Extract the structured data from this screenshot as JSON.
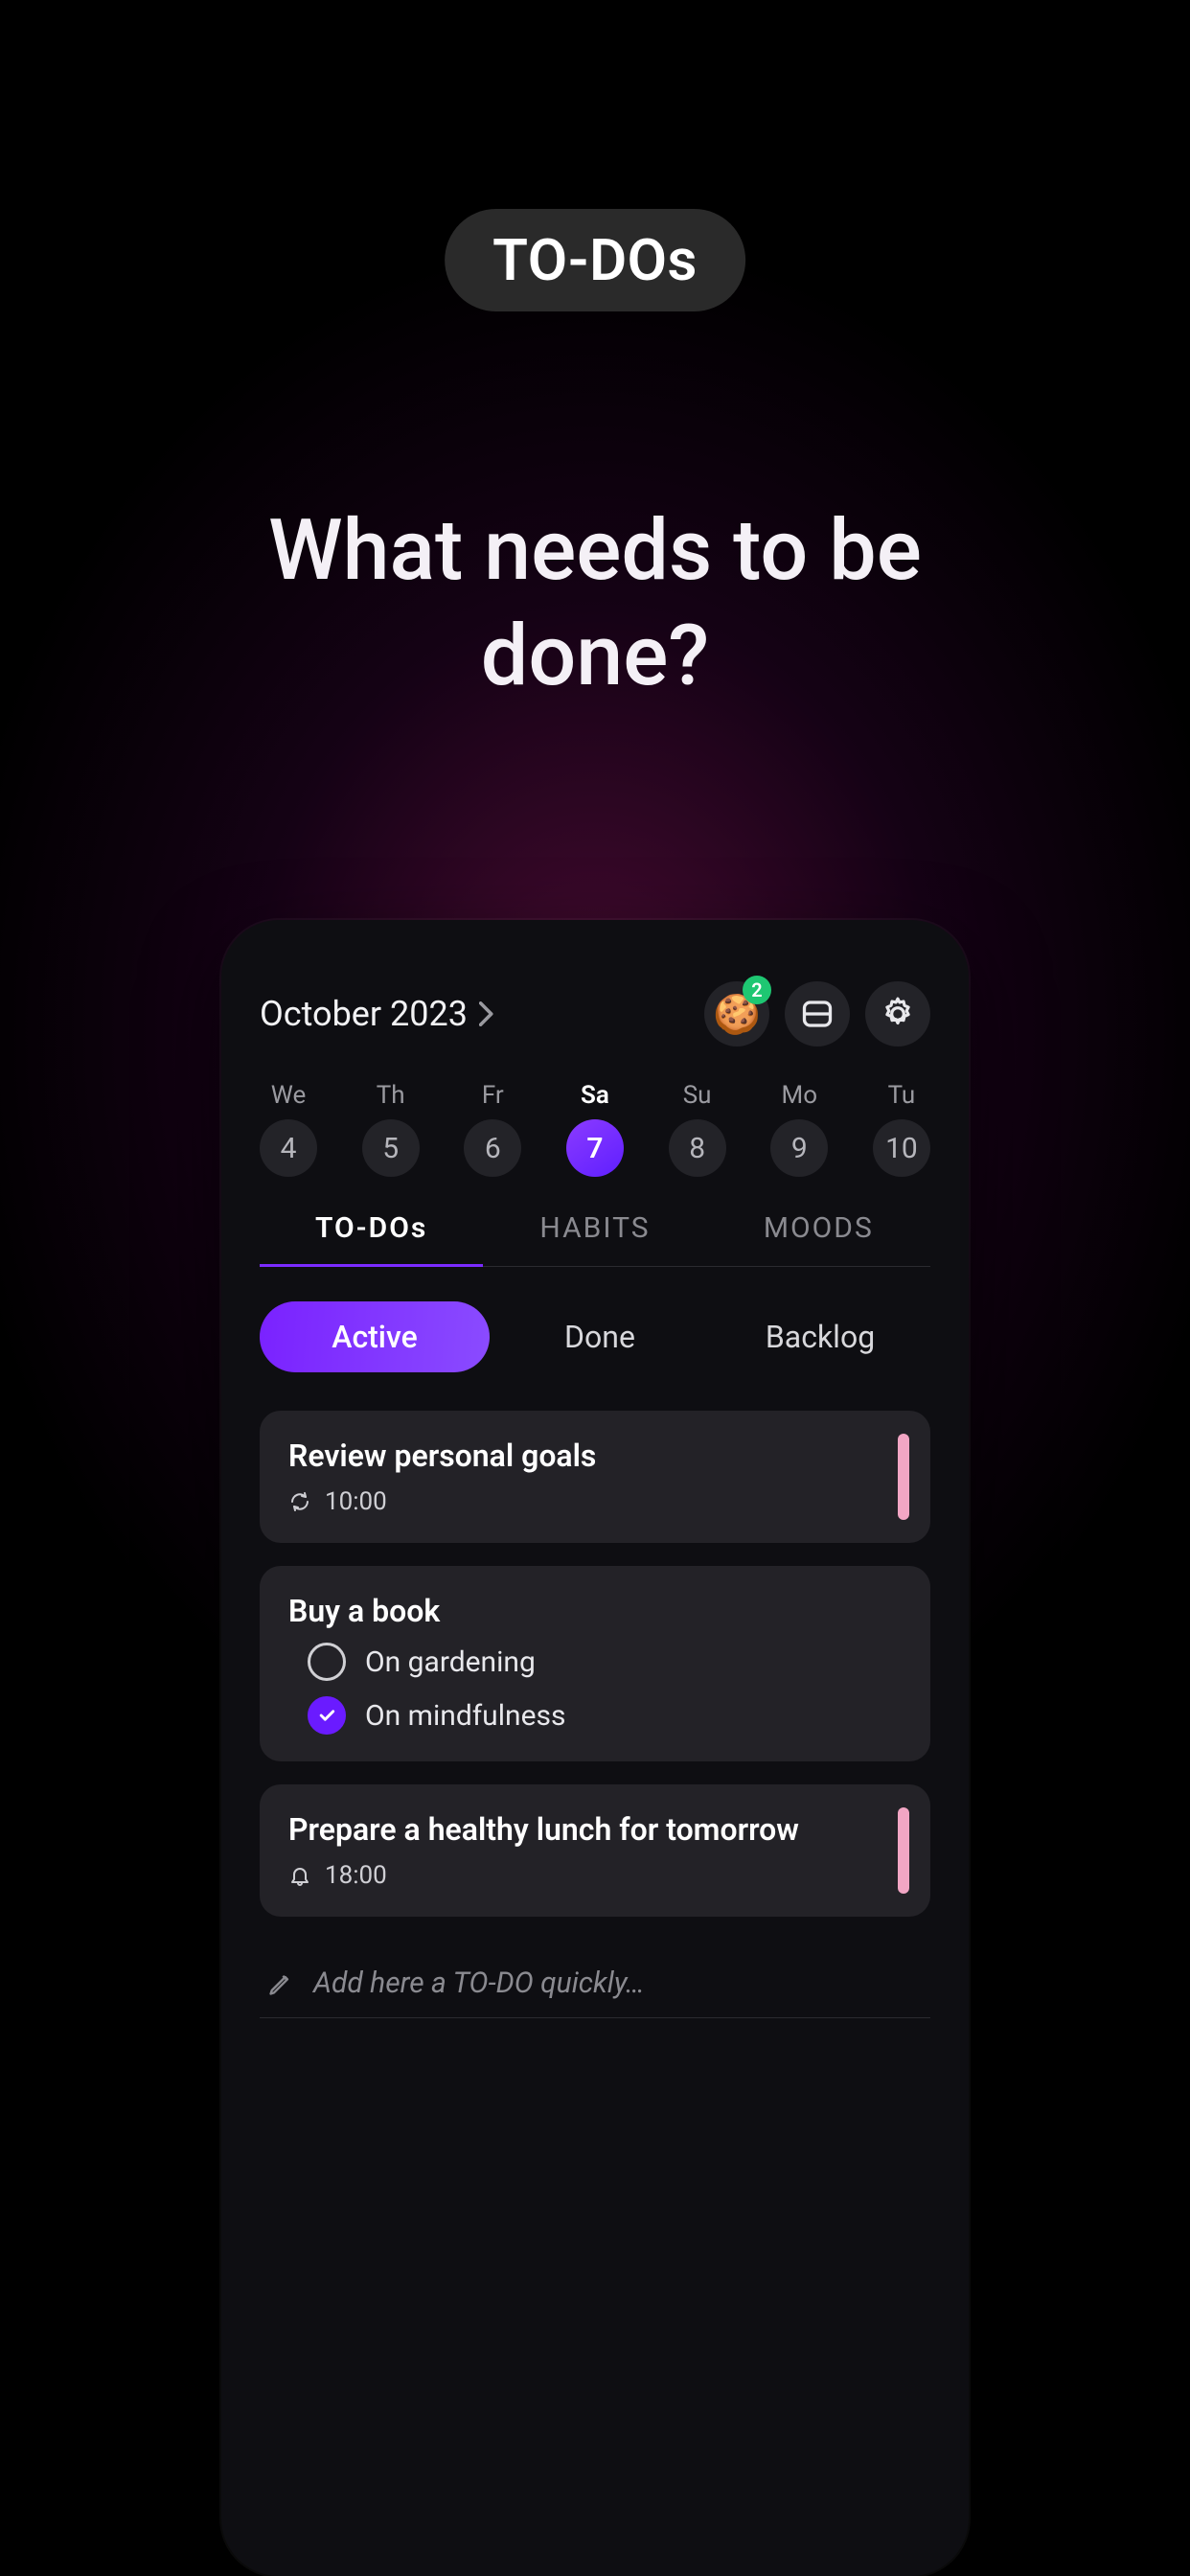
{
  "pill_label": "TO-DOs",
  "headline": "What needs to be done?",
  "month_title": "October 2023",
  "cookie_badge": "2",
  "days": [
    {
      "abbr": "We",
      "num": "4",
      "selected": false
    },
    {
      "abbr": "Th",
      "num": "5",
      "selected": false
    },
    {
      "abbr": "Fr",
      "num": "6",
      "selected": false
    },
    {
      "abbr": "Sa",
      "num": "7",
      "selected": true
    },
    {
      "abbr": "Su",
      "num": "8",
      "selected": false
    },
    {
      "abbr": "Mo",
      "num": "9",
      "selected": false
    },
    {
      "abbr": "Tu",
      "num": "10",
      "selected": false
    }
  ],
  "tabs": {
    "todos": "TO-DOs",
    "habits": "HABITS",
    "moods": "MOODS"
  },
  "filters": {
    "active": "Active",
    "done": "Done",
    "backlog": "Backlog"
  },
  "cards": {
    "c1": {
      "title": "Review personal goals",
      "time": "10:00",
      "meta_icon": "refresh"
    },
    "c2": {
      "title": "Buy a book",
      "sub": [
        {
          "label": "On gardening",
          "checked": false
        },
        {
          "label": "On mindfulness",
          "checked": true
        }
      ]
    },
    "c3": {
      "title": "Prepare a healthy lunch for tomorrow",
      "time": "18:00",
      "meta_icon": "bell"
    }
  },
  "quick_add_placeholder": "Add here a TO-DO quickly…",
  "colors": {
    "accent": "#7a22ff",
    "stripe": "#f2a6c4",
    "badge": "#1ec772"
  }
}
